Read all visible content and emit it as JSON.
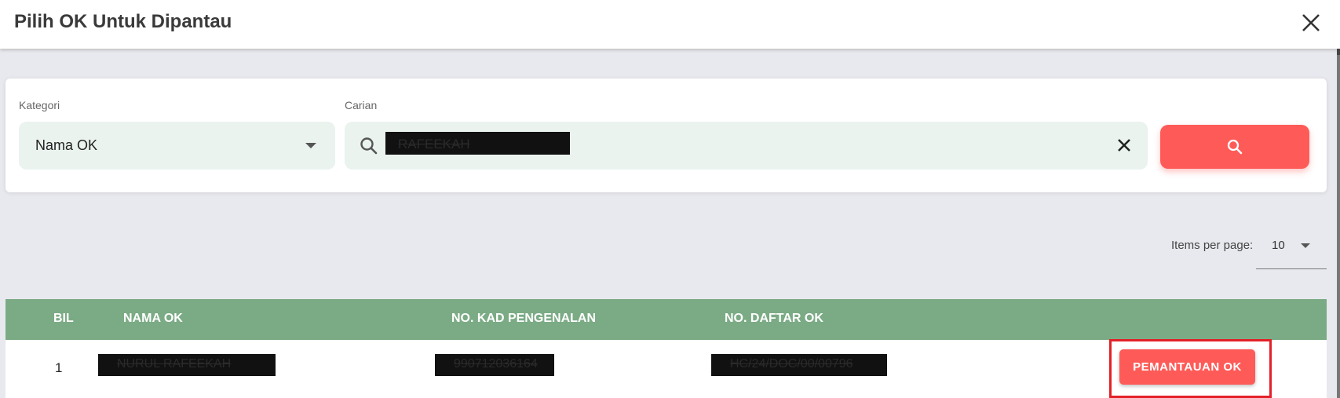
{
  "dialog": {
    "title": "Pilih OK Untuk Dipantau",
    "close_icon": "close-icon"
  },
  "filters": {
    "category_label": "Kategori",
    "category_value": "Nama OK",
    "search_label": "Carian",
    "search_value": "RAFEEKAH",
    "search_icon": "search-icon",
    "clear_icon": "clear-icon"
  },
  "pagination": {
    "items_per_page_label": "Items per page:",
    "items_per_page_value": "10"
  },
  "table": {
    "columns": [
      "BIL",
      "NAMA OK",
      "NO. KAD PENGENALAN",
      "NO. DAFTAR OK"
    ],
    "rows": [
      {
        "bil": "1",
        "nama_ok": "NURUL RAFEEKAH",
        "no_kad": "990712036164",
        "no_daftar": "HC/24/DOC/00/00796",
        "action_label": "PEMANTAUAN OK"
      }
    ]
  },
  "colors": {
    "accent": "#fe5b58",
    "table_header": "#7bab85",
    "input_bg": "#eaf3ee",
    "highlight_border": "#e32027"
  }
}
